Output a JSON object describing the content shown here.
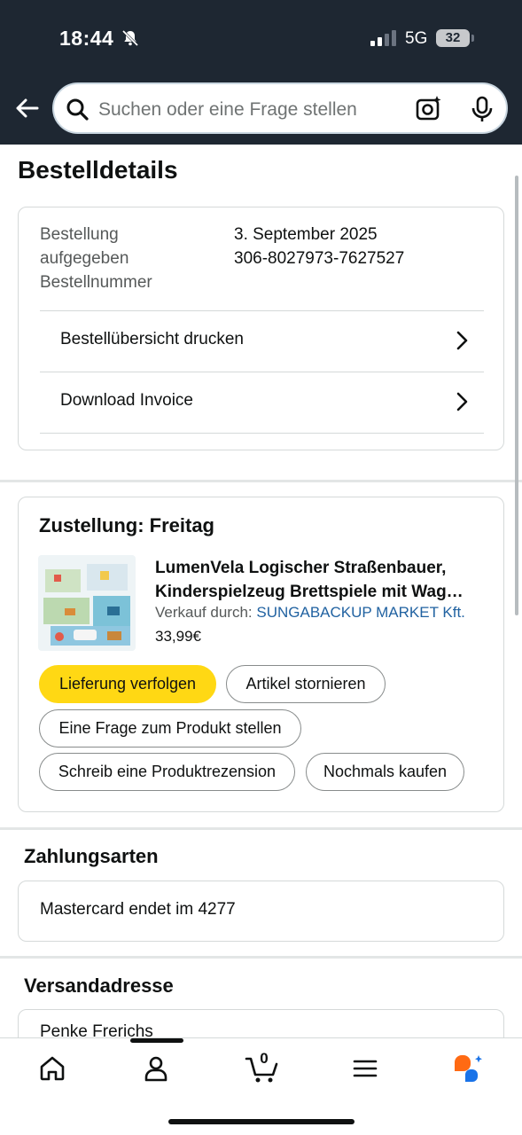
{
  "status_bar": {
    "time": "18:44",
    "network": "5G",
    "battery": "32"
  },
  "search": {
    "placeholder": "Suchen oder eine Frage stellen"
  },
  "page": {
    "title": "Bestelldetails"
  },
  "order": {
    "placed_label": "Bestellung aufgegeben",
    "placed_label_line1": "Bestellung",
    "placed_label_line2": "aufgegeben",
    "placed_value": "3. September 2025",
    "number_label": "Bestellnummer",
    "number_value": "306-8027973-7627527",
    "links": [
      "Bestellübersicht drucken",
      "Download Invoice"
    ]
  },
  "shipment": {
    "title": "Zustellung: Freitag",
    "product_line1": "LumenVela Logischer Straßenbauer,",
    "product_line2": "Kinderspielzeug Brettspiele mit Wag…",
    "seller_label": "Verkauf durch:",
    "seller_name": "SUNGABACKUP MARKET Kft.",
    "price": "33,99€",
    "buttons": {
      "track": "Lieferung verfolgen",
      "cancel": "Artikel stornieren",
      "ask": "Eine Frage zum Produkt stellen",
      "review": "Schreib eine Produktrezension",
      "rebuy": "Nochmals kaufen"
    }
  },
  "payment": {
    "title": "Zahlungsarten",
    "method": "Mastercard",
    "ending": "endet im 4277"
  },
  "address": {
    "title": "Versandadresse",
    "name": "Penke Frerichs"
  },
  "nav": {
    "cart_count": "0"
  },
  "colors": {
    "header_bg": "#1e2732",
    "primary_button": "#ffd814",
    "link": "#2162a1"
  }
}
